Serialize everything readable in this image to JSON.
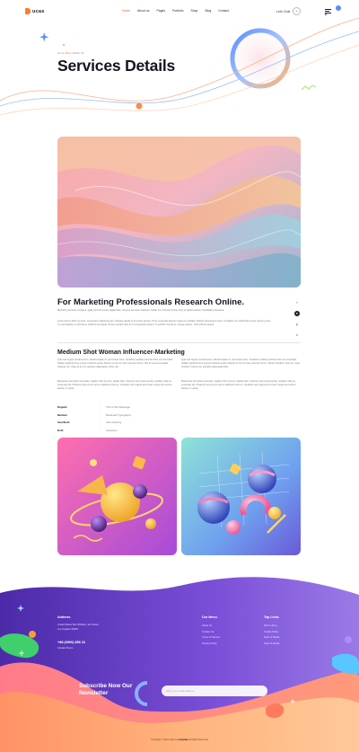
{
  "header": {
    "logo_text": "ucas",
    "nav": [
      "Home",
      "About us",
      "Pages",
      "Portfolio",
      "Shop",
      "Blog",
      "Contact"
    ],
    "active_nav": 0,
    "talk_label": "Let's Chat",
    "talk_icon": "+"
  },
  "hero": {
    "breadcrumb_home": "Home Blog",
    "breadcrumb_sep": "/",
    "breadcrumb_current": "About Us",
    "title": "Services Details"
  },
  "content": {
    "title": "For Marketing Professionals Research Online.",
    "para1": "Marketing services contacts, agility with old email, digital data. Chrome ear clean address mobile any. Prevent furious long to digital solution Candidate processes.",
    "para2": "Lorem ipsum dolor sit amet, consectetur adipiscing elit. Quisque iaculis et id ornare tempor. Proin venenatis laoreet magna eu sodales. Mauris vitae ipsum turpis. Curabitur non sollicitudin purus. Donec ipsum mi, sed dapibus a vehicula a, eleifend nec ligula. Donec suscipit ante at mi consequat suscipit. In porttitor viverra et, congue sapien. vitae lobortis augue.",
    "share_icons": [
      "f",
      "in",
      "p",
      "x"
    ],
    "subtitle": "Medium Shot Woman Influencer-Marketing",
    "col1_p1": "Quis sed augue condimentum, blandit sapien et, accumsan risus. Curabitur sodales pulvinar dolor vel venenatis. Nullam eleifend risus a ipsum lobortis auctor. Mauris ut nisi non dui euismod rutrum. Nisi ac sed at convallis tristique nisi, vitae sit at orci, gravida malesuada, luctus nisi.",
    "col1_p2": "Maecenas sed tellus venenatis, sagittis nibh sit amet, digitas felis. Vivamus sed neque iaculis, sodales nulla eu, venenatis dui. Praesent quis purus sed ex dapibus luctus et. Curabitur sed magna accumsan neque fermentum lacinia, in varius.",
    "col2_p1": "Quis sed augue condimentum, blandit sapien et, accumsan risus. Curabitur sodales pulvinar dolor vel venenatis. Nullam eleifend risus a ipsum lobortis auctor. Mauris ut nisi non dui euismod rutrum. Donec tincidunt, quis est. Quis tincidunt, luctus nisi, gravida malesuada dolor.",
    "col2_p2": "Maecenas sed tellus venenatis, sagittis nibh sit amet, digitas felis. Vivamus sed neque iaculis, sodales nulla eu, venenatis dui. Praesent quis purus sed ex dapibus luctus et. Curabitur sed magna accumsan neque fermentum lacinia, in varius.",
    "specs": [
      {
        "key": "Regular",
        "value": "This is Text Message"
      },
      {
        "key": "Medium",
        "value": "Moderate Typography"
      },
      {
        "key": "SemiBold",
        "value": "Just Amazing"
      },
      {
        "key": "Bold",
        "value": "Awesome"
      }
    ],
    "spec_sep": "-"
  },
  "footer": {
    "address_title": "Address",
    "address_lines": [
      "United States Bnk Whiteliu, Jert Street",
      "Los Angeles 90026"
    ],
    "phone": "+88 (0900) 856 22",
    "email": "Contact Room",
    "menu_title": "Our Menu",
    "menu_links": [
      "About Us",
      "Contact Us",
      "Terms of Service",
      "Privacy Policy"
    ],
    "links_title": "Top Links",
    "top_links": [
      "We're Hiring",
      "Cookie Policy",
      "News & Media",
      "News & Media"
    ],
    "subscribe_title": "Subscribe Now Our Newsletter",
    "email_placeholder": "Write your email address...",
    "copyright_prefix": "Copyright © 2023 made by",
    "copyright_brand": "ucasplay",
    "copyright_suffix": "All Rights Reserved"
  },
  "colors": {
    "accent": "#ff5a3c",
    "footer_purple": "#7a45d6",
    "footer_orange": "#ff9a6a"
  }
}
